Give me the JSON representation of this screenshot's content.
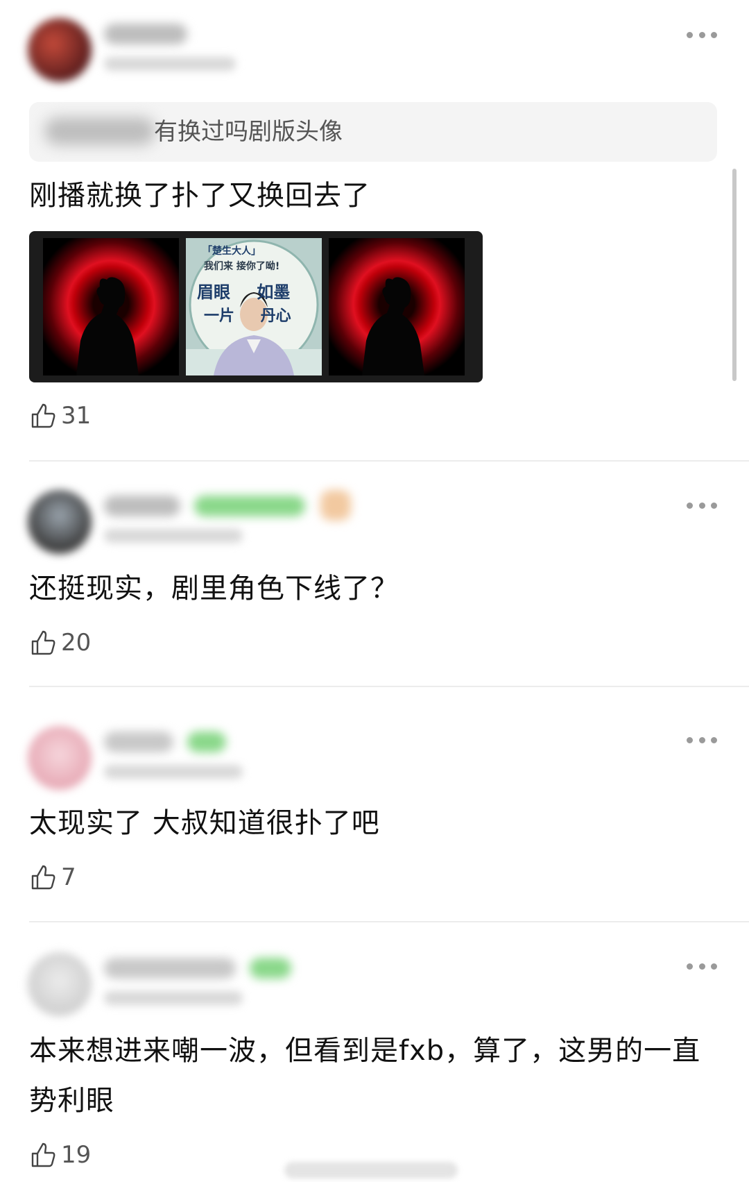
{
  "comments": [
    {
      "quote": "有换过吗剧版头像",
      "text": "刚播就换了扑了又换回去了",
      "likes": "31",
      "image_poster": {
        "tag": "「楚生大人」",
        "line1": "我们来 接你了呦!",
        "line2": "眉眼 如墨",
        "line3": "一片 丹心"
      }
    },
    {
      "text": "还挺现实，剧里角色下线了？",
      "likes": "20"
    },
    {
      "text": "太现实了 大叔知道很扑了吧",
      "likes": "7"
    },
    {
      "text": "本来想进来嘲一波，但看到是fxb，算了，这男的一直势利眼",
      "likes": "19"
    }
  ],
  "icons": {
    "like": "thumbs-up-icon",
    "more": "more-dots-icon"
  },
  "colors": {
    "background": "#ffffff",
    "text": "#111111",
    "secondary_text": "#555555",
    "quote_bg": "#f4f4f4",
    "divider": "#ececec"
  }
}
